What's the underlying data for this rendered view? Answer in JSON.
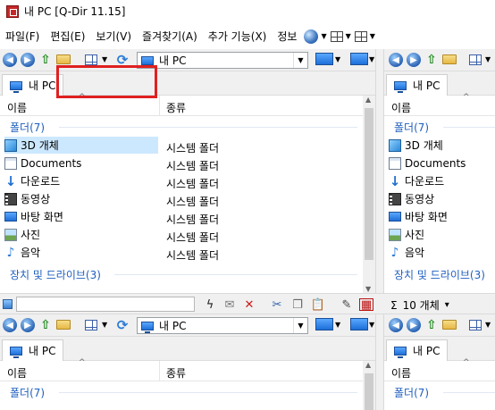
{
  "window": {
    "title": "내 PC  [Q-Dir 11.15]"
  },
  "menu": {
    "items": [
      "파일(F)",
      "편집(E)",
      "보기(V)",
      "즐겨찾기(A)",
      "추가 기능(X)",
      "정보"
    ]
  },
  "panes": {
    "top_left": {
      "address": "내 PC",
      "tab": "내 PC",
      "columns": {
        "name": "이름",
        "type": "종류"
      },
      "group_folders": "폴더(7)",
      "group_drives": "장치 및 드라이브(3)",
      "rows": [
        {
          "name": "3D 개체",
          "type": "시스템 폴더",
          "icon": "3d-objects-icon"
        },
        {
          "name": "Documents",
          "type": "시스템 폴더",
          "icon": "documents-icon"
        },
        {
          "name": "다운로드",
          "type": "시스템 폴더",
          "icon": "download-icon"
        },
        {
          "name": "동영상",
          "type": "시스템 폴더",
          "icon": "video-icon"
        },
        {
          "name": "바탕 화면",
          "type": "시스템 폴더",
          "icon": "desktop-icon"
        },
        {
          "name": "사진",
          "type": "시스템 폴더",
          "icon": "pictures-icon"
        },
        {
          "name": "음악",
          "type": "시스템 폴더",
          "icon": "music-icon"
        }
      ]
    },
    "top_right": {
      "tab": "내 PC",
      "columns": {
        "name": "이름"
      },
      "group_folders": "폴더(7)",
      "group_drives": "장치 및 드라이브(3)",
      "rows": [
        "3D 개체",
        "Documents",
        "다운로드",
        "동영상",
        "바탕 화면",
        "사진",
        "음악"
      ]
    },
    "bottom_left": {
      "address": "내 PC",
      "tab": "내 PC",
      "columns": {
        "name": "이름",
        "type": "종류"
      },
      "group_folders": "폴더(7)"
    },
    "bottom_right": {
      "tab": "내 PC",
      "columns": {
        "name": "이름"
      },
      "group_folders": "폴더(7)"
    }
  },
  "status": {
    "count": "10 개체",
    "sigma": "Σ",
    "caret": "▾"
  },
  "colors": {
    "accent": "#1f5fbf",
    "selection": "#cce8ff",
    "highlight": "#e02020"
  }
}
